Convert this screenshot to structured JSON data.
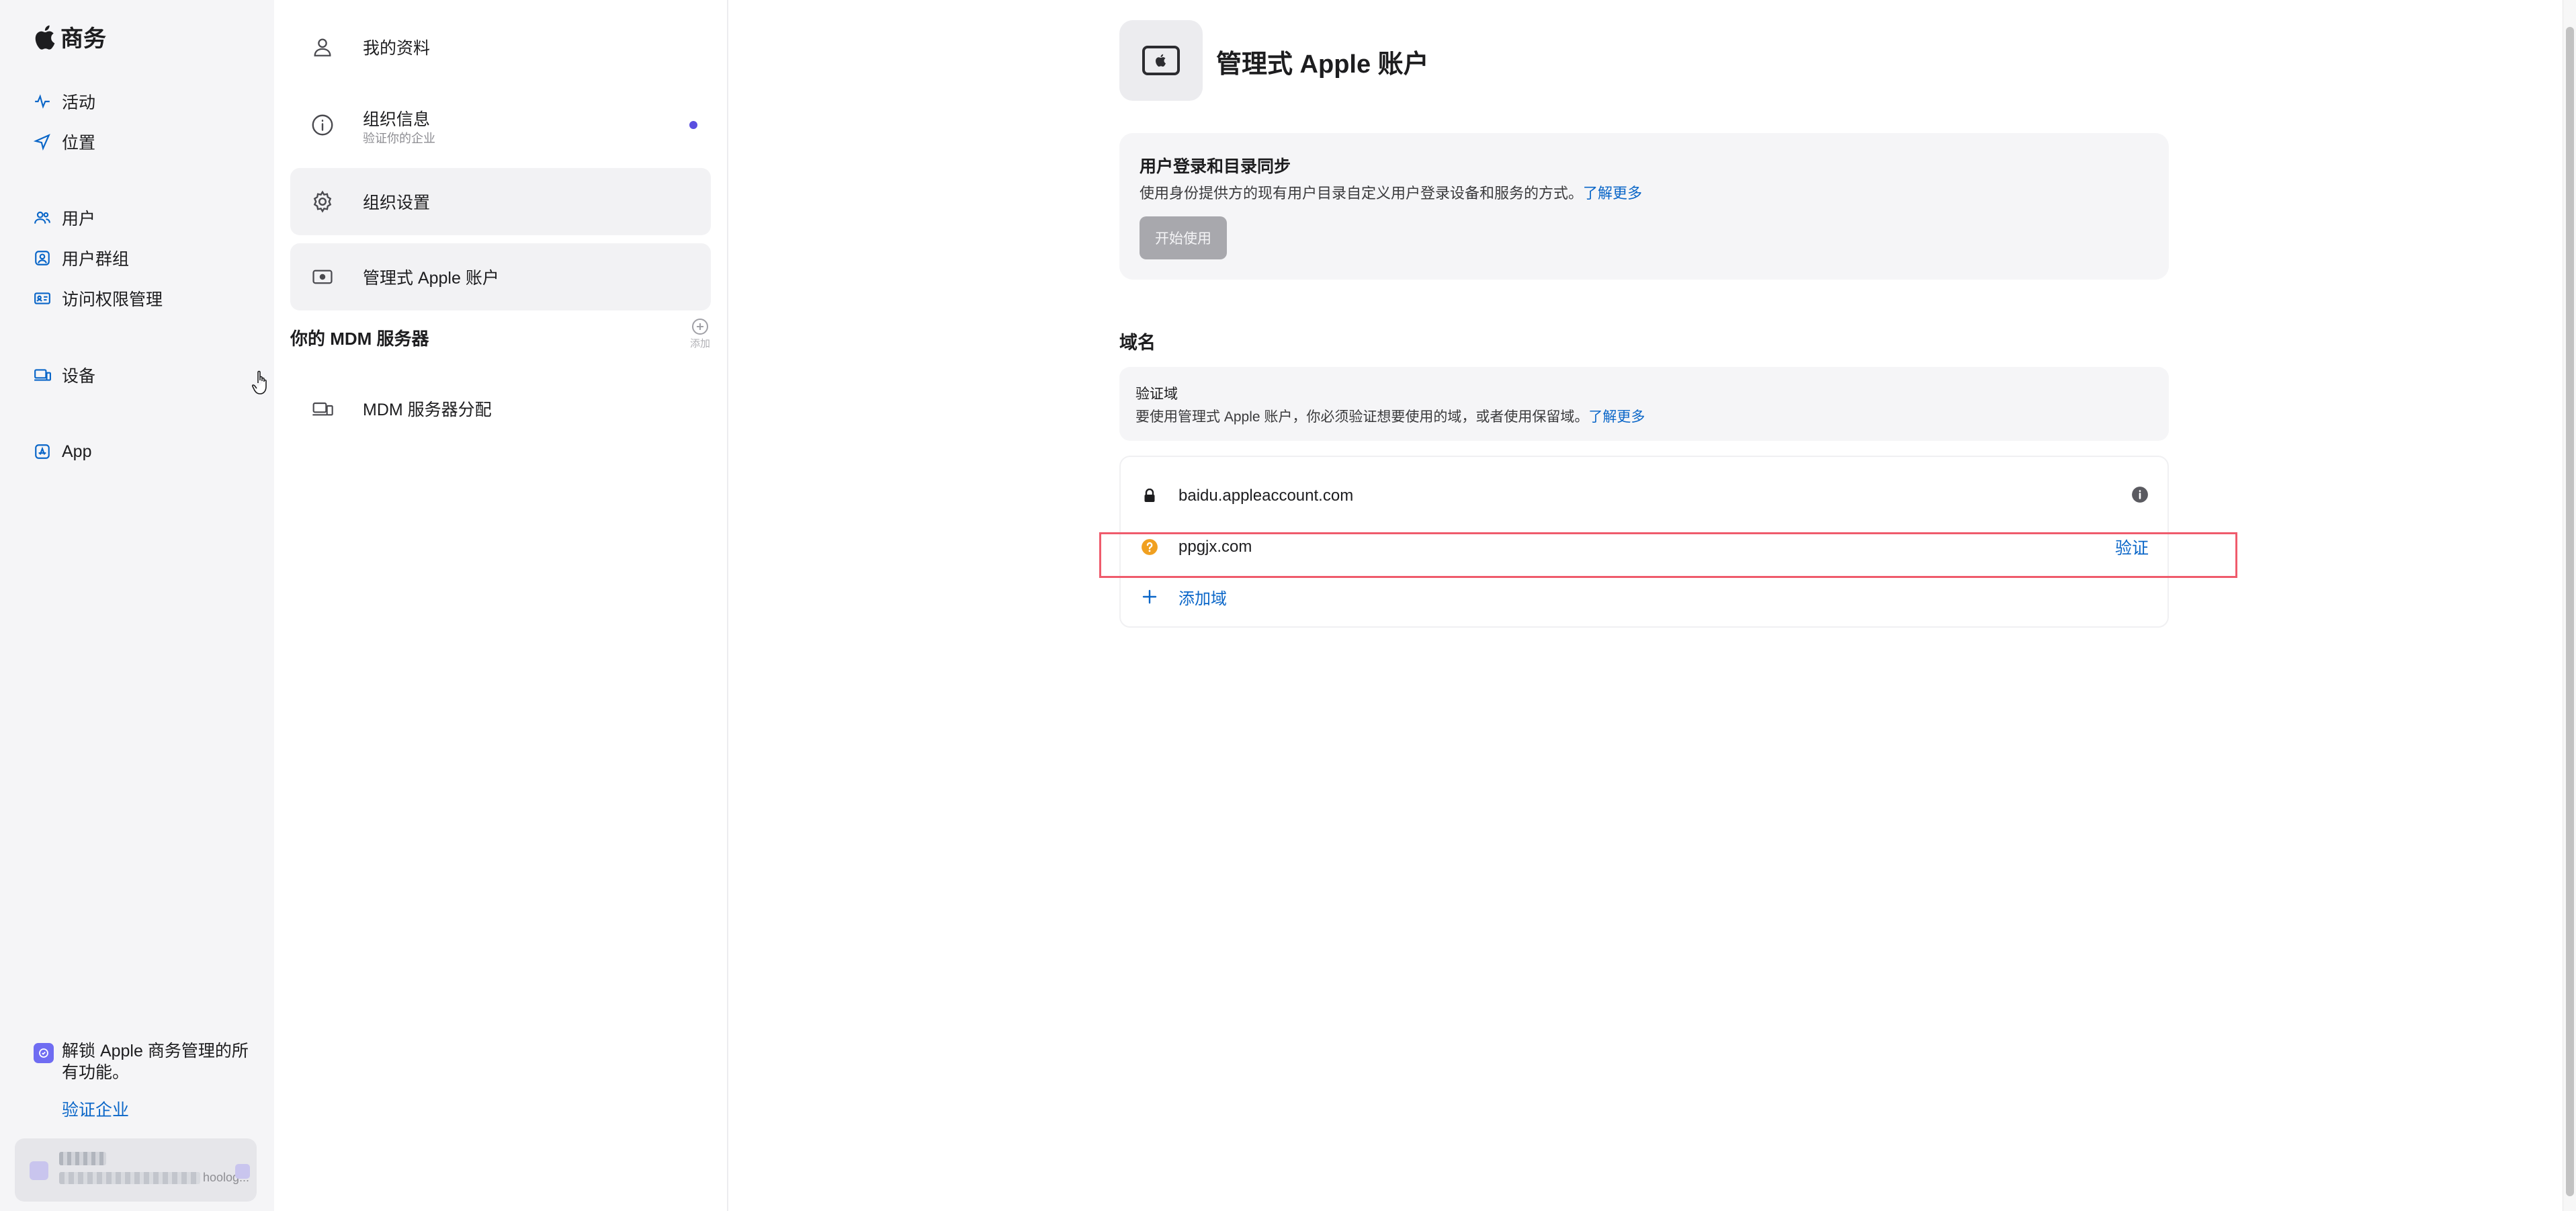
{
  "nav": {
    "brand": "商务",
    "items": [
      {
        "label": "活动",
        "icon": "activity-icon"
      },
      {
        "label": "位置",
        "icon": "location-arrow-icon"
      },
      {
        "label": "用户",
        "icon": "users-icon"
      },
      {
        "label": "用户群组",
        "icon": "user-group-icon"
      },
      {
        "label": "访问权限管理",
        "icon": "id-card-icon"
      },
      {
        "label": "设备",
        "icon": "devices-icon"
      },
      {
        "label": "App",
        "icon": "app-store-icon"
      }
    ],
    "promo_text": "解锁 Apple 商务管理的所有功能。",
    "promo_link": "验证企业",
    "account_trail": "hoolog..."
  },
  "settings": {
    "items": [
      {
        "label": "我的资料",
        "icon": "person-icon"
      },
      {
        "label": "组织信息",
        "sub": "验证你的企业",
        "icon": "info-circle-icon"
      },
      {
        "label": "组织设置",
        "icon": "gear-icon"
      },
      {
        "label": "管理式 Apple 账户",
        "icon": "apple-id-card-icon"
      }
    ],
    "mdm_section": "你的 MDM 服务器",
    "mdm_add": "添加",
    "mdm_item": "MDM 服务器分配"
  },
  "main": {
    "title": "管理式 Apple 账户",
    "sso_card": {
      "title": "用户登录和目录同步",
      "desc": "使用身份提供方的现有用户目录自定义用户登录设备和服务的方式。",
      "learn_more": "了解更多",
      "button": "开始使用"
    },
    "domains_heading": "域名",
    "verify_box": {
      "title": "验证域",
      "desc": "要使用管理式 Apple 账户，你必须验证想要使用的域，或者使用保留域。",
      "learn_more": "了解更多"
    },
    "domains": [
      {
        "name": "baidu.appleaccount.com",
        "status": "locked"
      },
      {
        "name": "ppgjx.com",
        "status": "unverified",
        "action": "验证"
      }
    ],
    "add_domain": "添加域"
  },
  "colors": {
    "accent": "#0a66c8",
    "warning": "#f0a020",
    "highlight": "#ef5b6c",
    "sidebar_bg": "#f5f5f7"
  }
}
